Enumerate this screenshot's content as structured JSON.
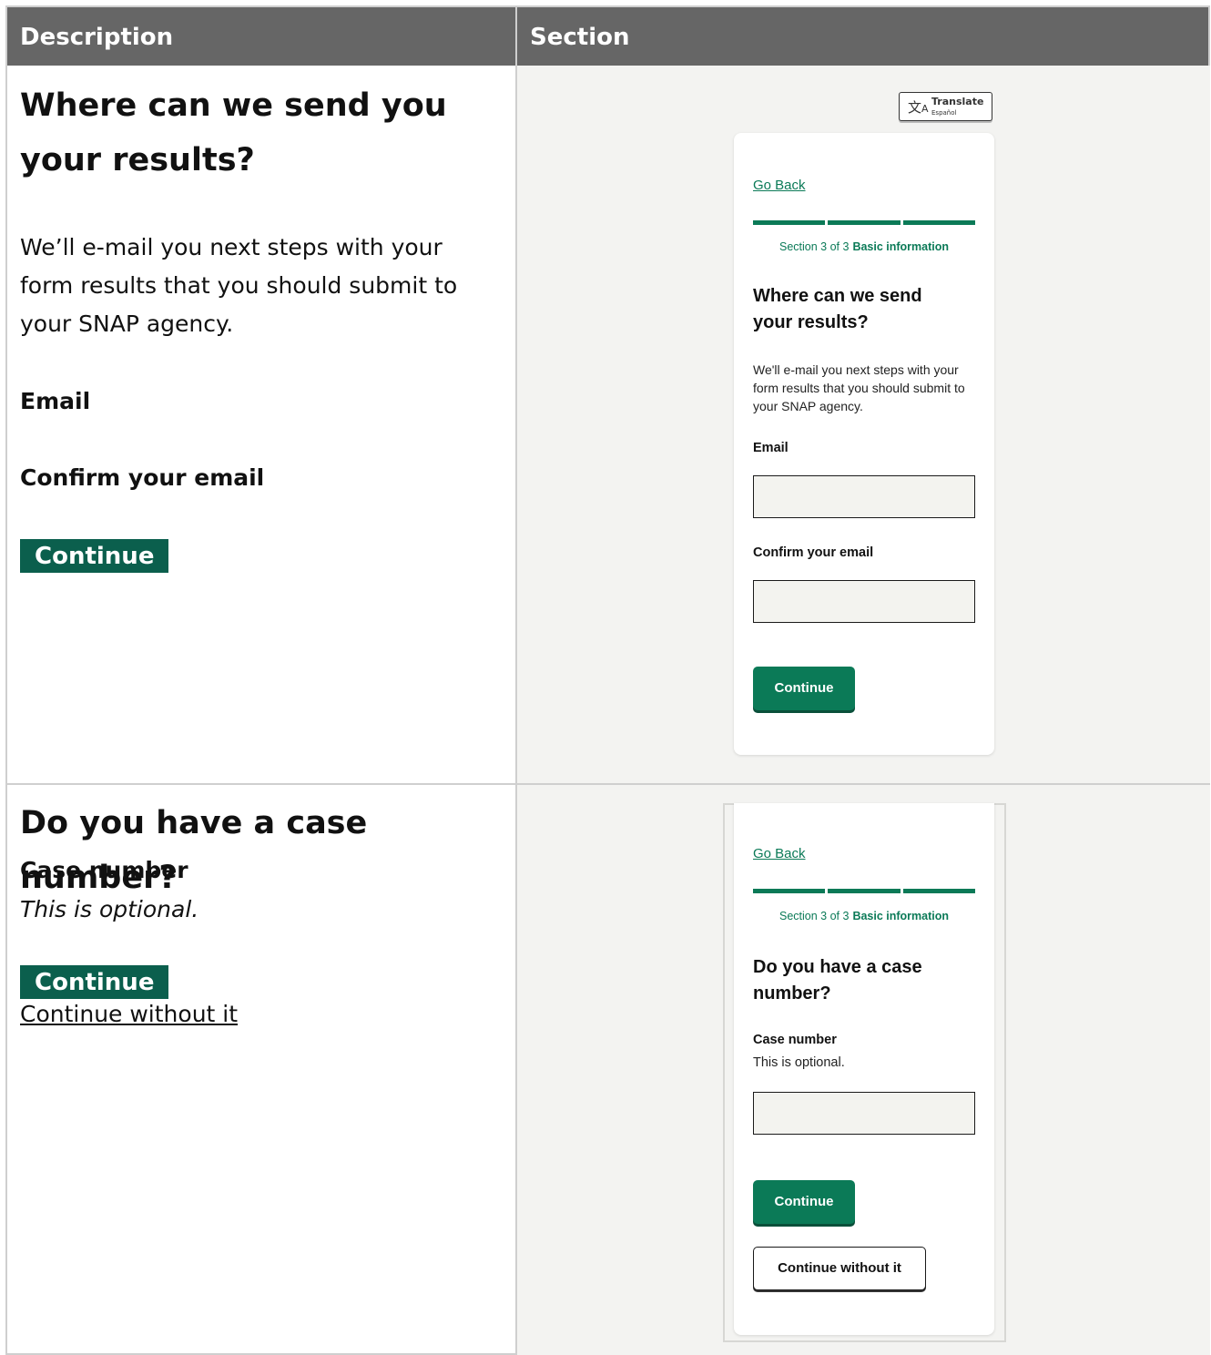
{
  "table": {
    "col1_header": "Description",
    "col2_header": "Section"
  },
  "row1": {
    "description": {
      "title": "Where can we send you your results?",
      "text": "We’ll e-mail you next steps with your form results that you should submit to your SNAP agency.",
      "email_label": "Email",
      "confirm_label": "Confirm your email",
      "continue_label": "Continue"
    },
    "mockup": {
      "translate_label": "Translate",
      "translate_sub": "Español",
      "translate_icon": "translate-icon",
      "go_back": "Go Back",
      "section_prefix": "Section 3 of 3",
      "section_name": "Basic information",
      "progress_segments": 3,
      "title": "Where can we send your results?",
      "text": "We'll e-mail you next steps with your form results that you should submit to your SNAP agency.",
      "email_label": "Email",
      "email_value": "",
      "confirm_label": "Confirm your email",
      "confirm_value": "",
      "continue_label": "Continue"
    }
  },
  "row2": {
    "description": {
      "title": "Do you have a case number?",
      "case_label": "Case number",
      "hint": "This is optional.",
      "continue_label": "Continue",
      "continue_without_label": "Continue without it"
    },
    "mockup": {
      "go_back": "Go Back",
      "section_prefix": "Section 3 of 3",
      "section_name": "Basic information",
      "progress_segments": 3,
      "title": "Do you have a case number?",
      "case_label": "Case number",
      "hint": "This is optional.",
      "case_value": "",
      "continue_label": "Continue",
      "continue_without_label": "Continue without it"
    }
  },
  "colors": {
    "header_bg": "#666666",
    "accent_green": "#0b7a57",
    "description_button_green": "#0b5f4d",
    "section_bg": "#f3f3f1"
  }
}
